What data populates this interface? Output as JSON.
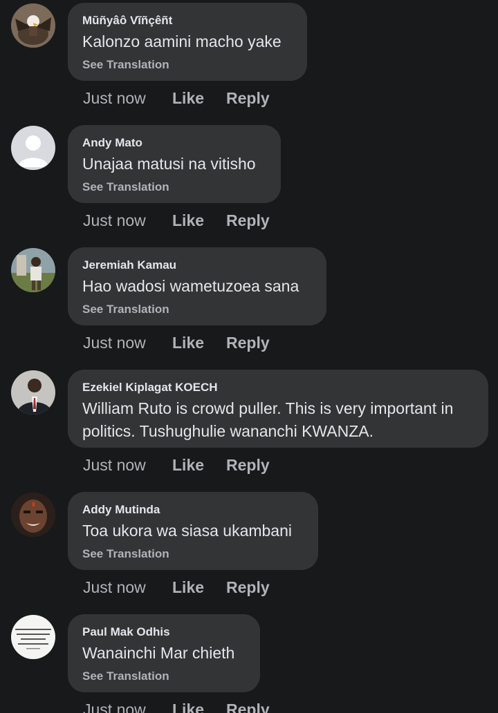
{
  "comments": [
    {
      "author": "Mũñyâô Vĩñçêñt",
      "text": "Kalonzo aamini macho yake",
      "see_translation": "See Translation",
      "time": "Just now",
      "like": "Like",
      "reply": "Reply",
      "avatar": "eagle-avatar"
    },
    {
      "author": "Andy Mato",
      "text": "Unajaa matusi na vitisho",
      "see_translation": "See Translation",
      "time": "Just now",
      "like": "Like",
      "reply": "Reply",
      "avatar": "default-profile-avatar"
    },
    {
      "author": "Jeremiah Kamau",
      "text": "Hao wadosi wametuzoea sana",
      "see_translation": "See Translation",
      "time": "Just now",
      "like": "Like",
      "reply": "Reply",
      "avatar": "outdoor-photo-avatar"
    },
    {
      "author": "Ezekiel Kiplagat KOECH",
      "text_lines": [
        "William Ruto is crowd puller. This is very important in",
        "politics. Tushughulie wananchi KWANZA."
      ],
      "time": "Just now",
      "like": "Like",
      "reply": "Reply",
      "avatar": "suit-portrait-avatar"
    },
    {
      "author": "Addy Mutinda",
      "text": "Toa ukora wa siasa ukambani",
      "see_translation": "See Translation",
      "time": "Just now",
      "like": "Like",
      "reply": "Reply",
      "avatar": "face-portrait-avatar"
    },
    {
      "author": "Paul Mak Odhis",
      "text": "Wanainchi Mar chieth",
      "see_translation": "See Translation",
      "time": "Just now",
      "like": "Like",
      "reply": "Reply",
      "avatar": "quote-text-avatar"
    }
  ]
}
